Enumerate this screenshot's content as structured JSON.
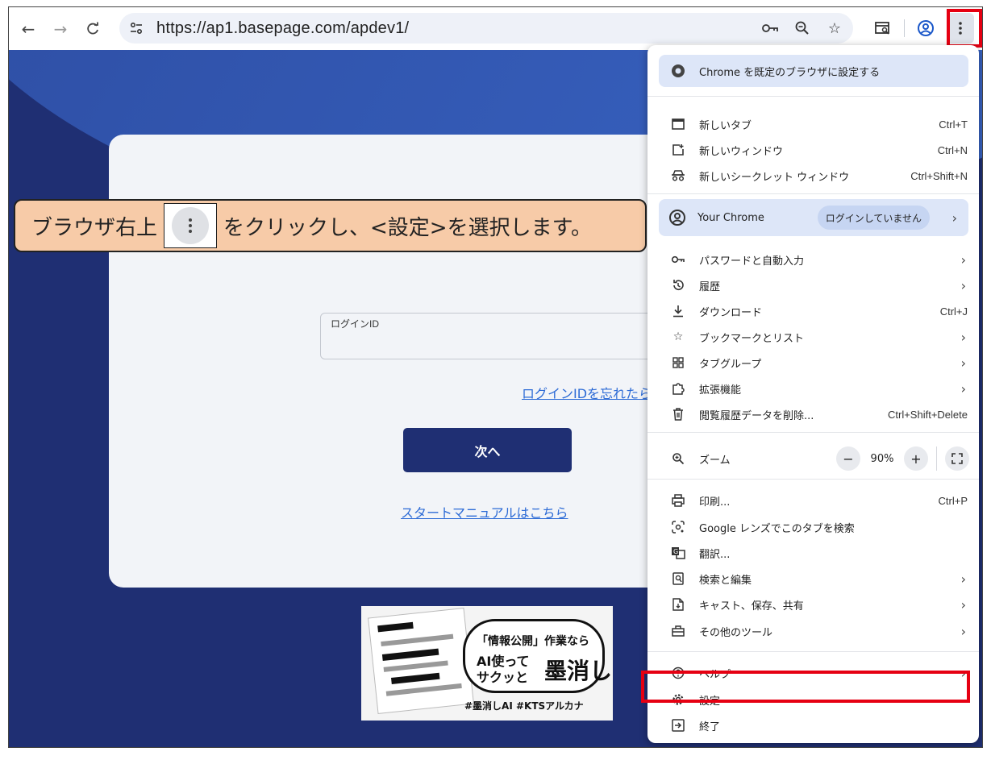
{
  "toolbar": {
    "url": "https://ap1.basepage.com/apdev1/",
    "icons": [
      "back-icon",
      "forward-icon",
      "reload-icon",
      "site-info-icon",
      "password-key-icon",
      "zoom-icon",
      "bookmark-star-icon",
      "tab-search-icon",
      "profile-icon",
      "kebab-menu-icon"
    ]
  },
  "page": {
    "login_label": "ログインID",
    "forgot_link": "ログインIDを忘れたら",
    "next_button": "次へ",
    "manual_link": "スタートマニュアルはこちら"
  },
  "banner": {
    "line1": "「情報公開」作業なら",
    "line2": "AI使って",
    "line3": "サクッと",
    "big": "墨消し",
    "tags": "#墨消しAI  #KTSアルカナ"
  },
  "callout": {
    "before": "ブラウザ右上",
    "after": "をクリックし、<設定>を選択します。"
  },
  "menu": {
    "default_banner": "Chrome を既定のブラウザに設定する",
    "new_tab": {
      "label": "新しいタブ",
      "shortcut": "Ctrl+T"
    },
    "new_window": {
      "label": "新しいウィンドウ",
      "shortcut": "Ctrl+N"
    },
    "incognito": {
      "label": "新しいシークレット ウィンドウ",
      "shortcut": "Ctrl+Shift+N"
    },
    "your_chrome": {
      "label": "Your Chrome",
      "status": "ログインしていません"
    },
    "passwords": "パスワードと自動入力",
    "history": "履歴",
    "downloads": {
      "label": "ダウンロード",
      "shortcut": "Ctrl+J"
    },
    "bookmarks": "ブックマークとリスト",
    "tab_groups": "タブグループ",
    "extensions": "拡張機能",
    "clear_data": {
      "label": "閲覧履歴データを削除...",
      "shortcut": "Ctrl+Shift+Delete"
    },
    "zoom": {
      "label": "ズーム",
      "value": "90%",
      "minus": "−",
      "plus": "+"
    },
    "print": {
      "label": "印刷...",
      "shortcut": "Ctrl+P"
    },
    "lens": "Google レンズでこのタブを検索",
    "translate": "翻訳...",
    "find_edit": "検索と編集",
    "cast": "キャスト、保存、共有",
    "more_tools": "その他のツール",
    "help": "ヘルプ",
    "settings": "設定",
    "exit": "終了"
  }
}
